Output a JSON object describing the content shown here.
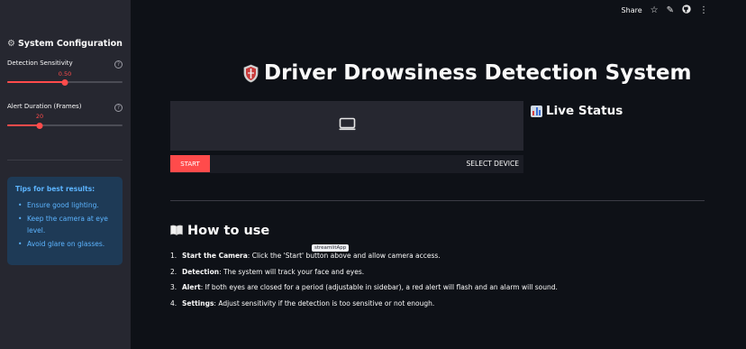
{
  "sidebar": {
    "title": "System Configuration",
    "sliders": [
      {
        "label": "Detection Sensitivity",
        "value_label": "0.50",
        "fraction": 0.5
      },
      {
        "label": "Alert Duration (Frames)",
        "value_label": "20",
        "fraction": 0.28
      }
    ],
    "tips": {
      "title": "Tips for best results:",
      "items": [
        "Ensure good lighting.",
        "Keep the camera at eye level.",
        "Avoid glare on glasses."
      ]
    }
  },
  "header": {
    "share_label": "Share"
  },
  "main": {
    "title": "Driver Drowsiness Detection System",
    "live_status": "Live Status",
    "camera": {
      "start_label": "START",
      "select_device_label": "SELECT DEVICE"
    },
    "howto": {
      "title": "How to use",
      "tooltip": "streamlitApp",
      "steps": [
        {
          "num": "1.",
          "bold": "Start the Camera",
          "text": ": Click the 'Start' button above and allow camera access."
        },
        {
          "num": "2.",
          "bold": "Detection",
          "text": ": The system will track your face and eyes."
        },
        {
          "num": "3.",
          "bold": "Alert",
          "text": ": If both eyes are closed for a period (adjustable in sidebar), a red alert will flash and an alarm will sound."
        },
        {
          "num": "4.",
          "bold": "Settings",
          "text": ": Adjust sensitivity if the detection is too sensitive or not enough."
        }
      ]
    }
  },
  "colors": {
    "accent": "#ff4b4b",
    "background": "#0e1117",
    "sidebar": "#262730",
    "tips_bg": "#1e3a56",
    "tips_text": "#5cb4ff"
  },
  "icons": {
    "settings": "gear-icon",
    "title": "shield-icon",
    "status": "bar-chart-icon",
    "howto": "book-icon",
    "camera": "monitor-icon"
  }
}
